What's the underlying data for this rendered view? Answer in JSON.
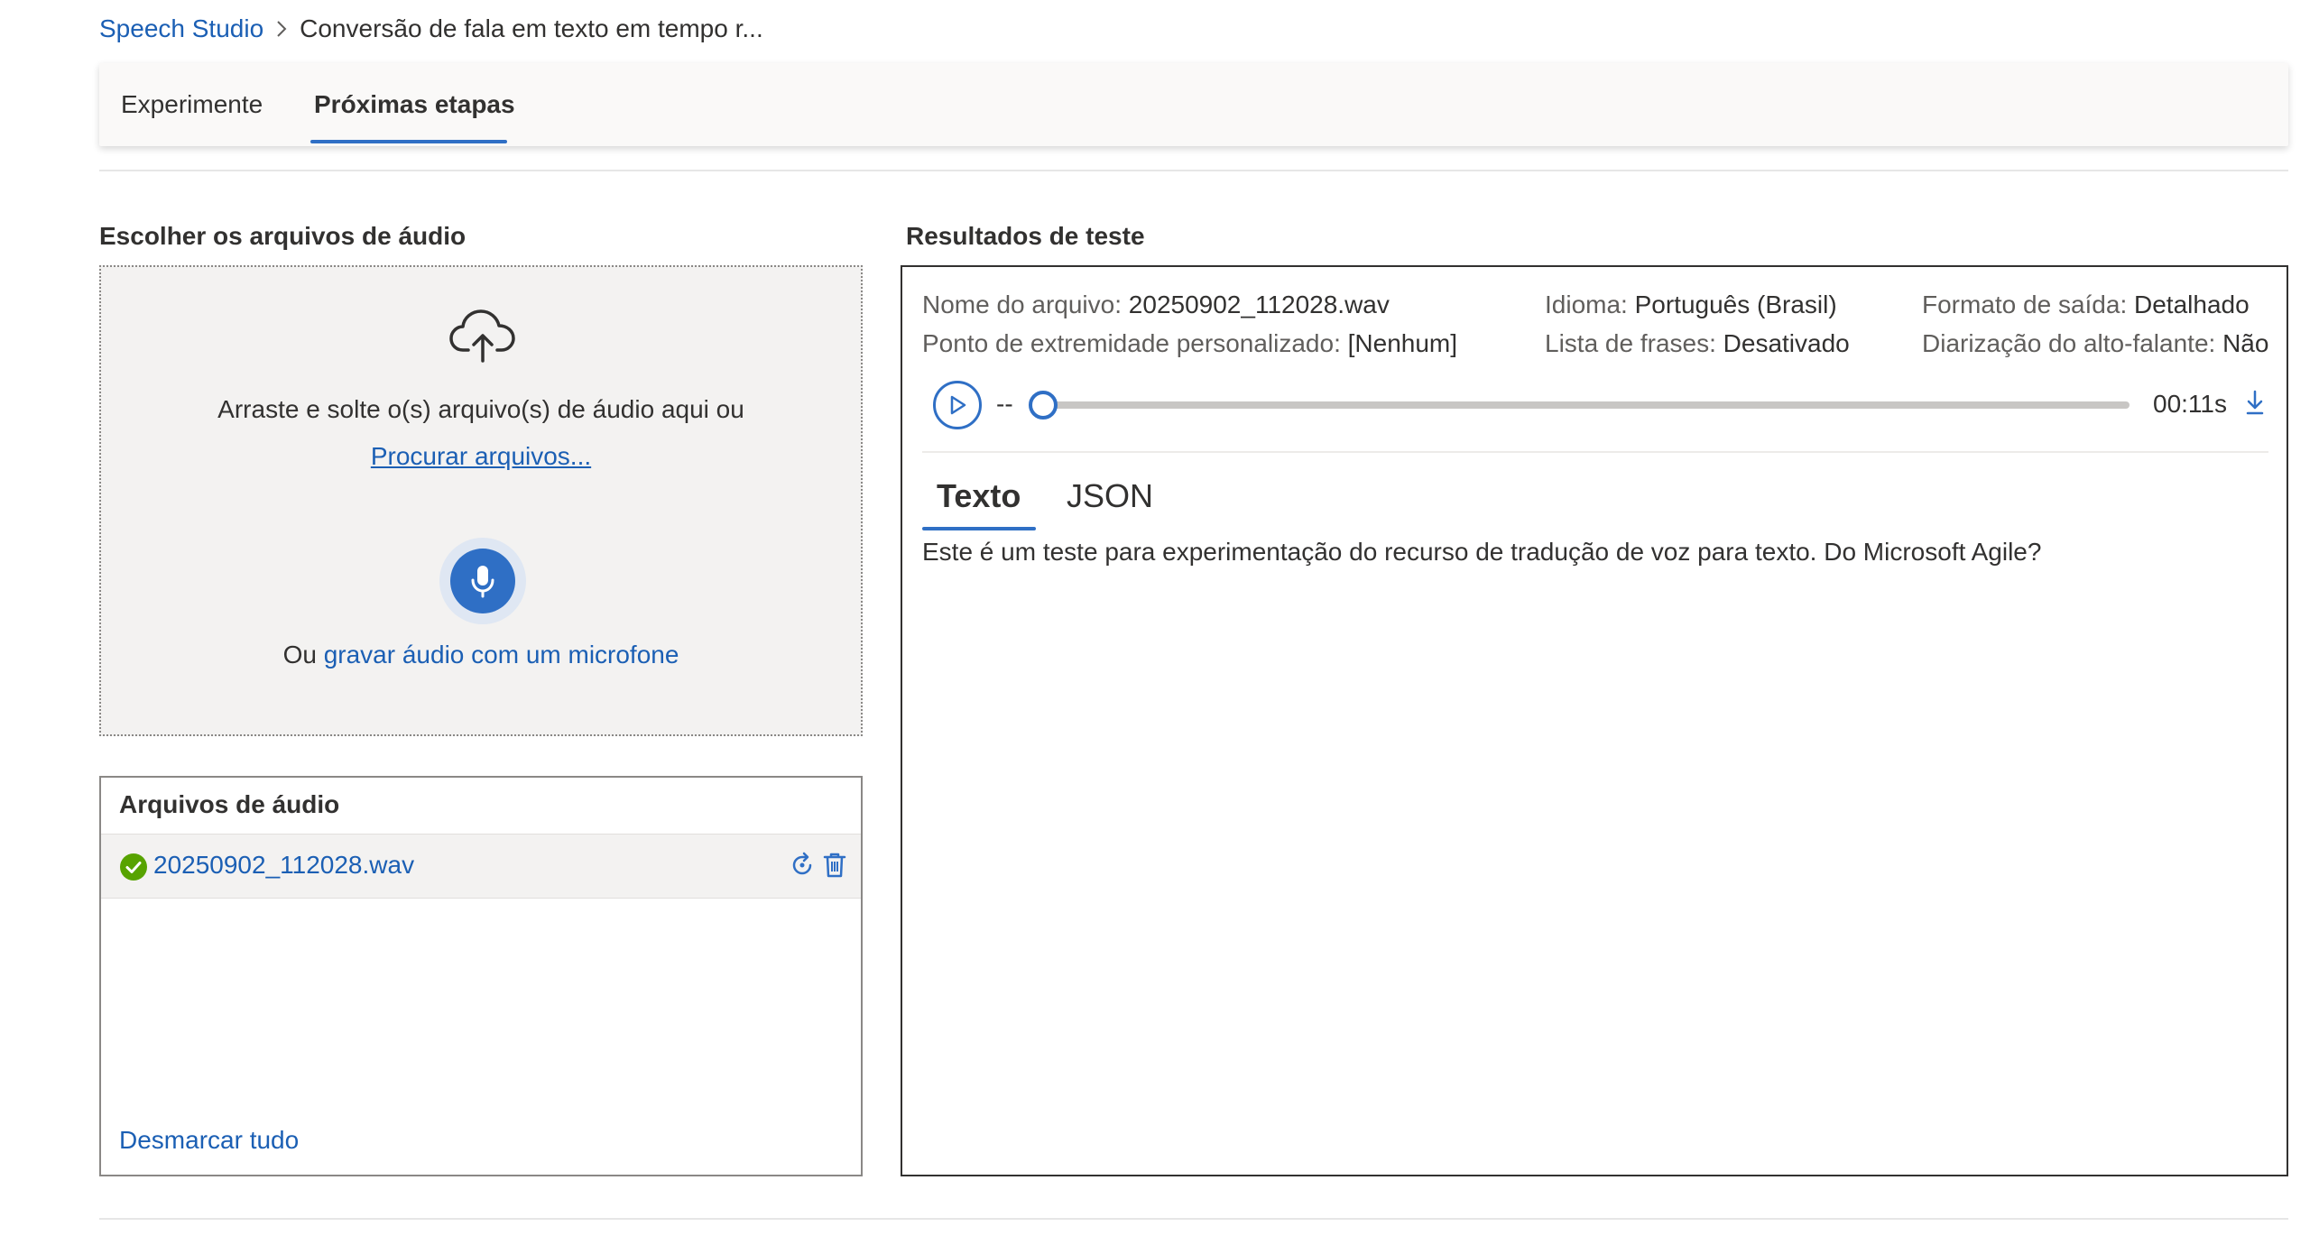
{
  "breadcrumb": {
    "root": "Speech Studio",
    "current": "Conversão de fala em texto em tempo r..."
  },
  "tabs": [
    {
      "label": "Experimente",
      "active": false
    },
    {
      "label": "Próximas etapas",
      "active": true
    }
  ],
  "upload": {
    "title": "Escolher os arquivos de áudio",
    "drop_text": "Arraste e solte o(s) arquivo(s) de áudio aqui ou",
    "browse_link": "Procurar arquivos...",
    "record_prefix": "Ou",
    "record_link": "gravar áudio com um microfone"
  },
  "files": {
    "title": "Arquivos de áudio",
    "items": [
      {
        "name": "20250902_112028.wav",
        "status": "success"
      }
    ],
    "deselect_all": "Desmarcar tudo"
  },
  "results": {
    "title": "Resultados de teste",
    "meta": {
      "file_label": "Nome do arquivo:",
      "file_value": "20250902_112028.wav",
      "language_label": "Idioma:",
      "language_value": "Português (Brasil)",
      "format_label": "Formato de saída:",
      "format_value": "Detalhado",
      "endpoint_label": "Ponto de extremidade personalizado:",
      "endpoint_value": "[Nenhum]",
      "phrases_label": "Lista de frases:",
      "phrases_value": "Desativado",
      "diarization_label": "Diarização do alto-falante:",
      "diarization_value": "Não"
    },
    "player": {
      "elapsed": "--",
      "duration": "00:11s",
      "progress": 0
    },
    "tabs": [
      {
        "label": "Texto",
        "active": true
      },
      {
        "label": "JSON",
        "active": false
      }
    ],
    "transcript": "Este é um teste para experimentação do recurso de tradução de voz para texto. Do Microsoft Agile?"
  },
  "colors": {
    "accent": "#2f6fc5",
    "link": "#1b5fb4",
    "success": "#57a300"
  }
}
